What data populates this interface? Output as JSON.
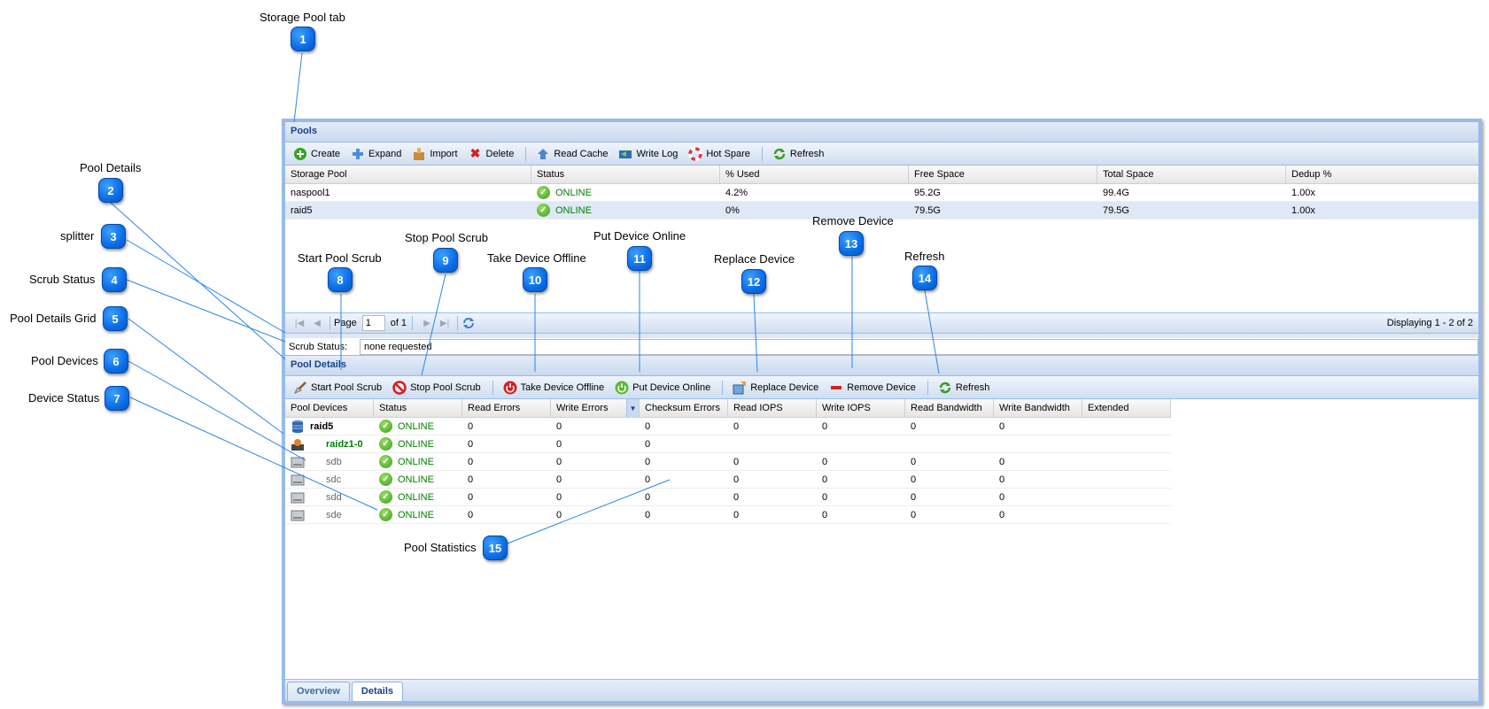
{
  "callouts": [
    {
      "n": "1",
      "label": "Storage Pool tab"
    },
    {
      "n": "2",
      "label": "Pool Details"
    },
    {
      "n": "3",
      "label": "splitter"
    },
    {
      "n": "4",
      "label": "Scrub Status"
    },
    {
      "n": "5",
      "label": "Pool Details Grid"
    },
    {
      "n": "6",
      "label": "Pool Devices"
    },
    {
      "n": "7",
      "label": "Device Status"
    },
    {
      "n": "8",
      "label": "Start Pool Scrub"
    },
    {
      "n": "9",
      "label": "Stop Pool Scrub"
    },
    {
      "n": "10",
      "label": "Take Device Offline"
    },
    {
      "n": "11",
      "label": "Put Device Online"
    },
    {
      "n": "12",
      "label": "Replace Device"
    },
    {
      "n": "13",
      "label": "Remove Device"
    },
    {
      "n": "14",
      "label": "Refresh"
    },
    {
      "n": "15",
      "label": "Pool Statistics"
    }
  ],
  "pools": {
    "title": "Pools",
    "toolbar": {
      "create": "Create",
      "expand": "Expand",
      "import": "Import",
      "delete": "Delete",
      "read_cache": "Read Cache",
      "write_log": "Write Log",
      "hot_spare": "Hot Spare",
      "refresh": "Refresh"
    },
    "columns": [
      "Storage Pool",
      "Status",
      "% Used",
      "Free Space",
      "Total Space",
      "Dedup %"
    ],
    "rows": [
      [
        "naspool1",
        "ONLINE",
        "4.2%",
        "95.2G",
        "99.4G",
        "1.00x"
      ],
      [
        "raid5",
        "ONLINE",
        "0%",
        "79.5G",
        "79.5G",
        "1.00x"
      ]
    ],
    "pager": {
      "page_label": "Page",
      "page_value": "1",
      "of_label": "of 1",
      "displaying": "Displaying 1 - 2 of 2"
    }
  },
  "scrub": {
    "label": "Scrub Status:",
    "value": "none requested"
  },
  "details": {
    "title": "Pool Details",
    "toolbar": {
      "start_scrub": "Start Pool Scrub",
      "stop_scrub": "Stop Pool Scrub",
      "take_offline": "Take Device Offline",
      "put_online": "Put Device Online",
      "replace": "Replace Device",
      "remove": "Remove Device",
      "refresh": "Refresh"
    },
    "columns": [
      "Pool Devices",
      "Status",
      "Read Errors",
      "Write Errors",
      "Checksum Errors",
      "Read IOPS",
      "Write IOPS",
      "Read Bandwidth",
      "Write Bandwidth",
      "Extended"
    ],
    "rows": [
      [
        "raid5",
        "ONLINE",
        "0",
        "0",
        "0",
        "0",
        "0",
        "0",
        "0",
        ""
      ],
      [
        "raidz1-0",
        "ONLINE",
        "0",
        "0",
        "0",
        "",
        "",
        "",
        "",
        ""
      ],
      [
        "sdb",
        "ONLINE",
        "0",
        "0",
        "0",
        "0",
        "0",
        "0",
        "0",
        ""
      ],
      [
        "sdc",
        "ONLINE",
        "0",
        "0",
        "0",
        "0",
        "0",
        "0",
        "0",
        ""
      ],
      [
        "sdd",
        "ONLINE",
        "0",
        "0",
        "0",
        "0",
        "0",
        "0",
        "0",
        ""
      ],
      [
        "sde",
        "ONLINE",
        "0",
        "0",
        "0",
        "0",
        "0",
        "0",
        "0",
        ""
      ]
    ]
  },
  "tabs": {
    "overview": "Overview",
    "details": "Details"
  },
  "colors": {
    "accent": "#0a6ee8",
    "panel_border": "#99bbe8",
    "header_text": "#15428b",
    "online": "#008000"
  }
}
